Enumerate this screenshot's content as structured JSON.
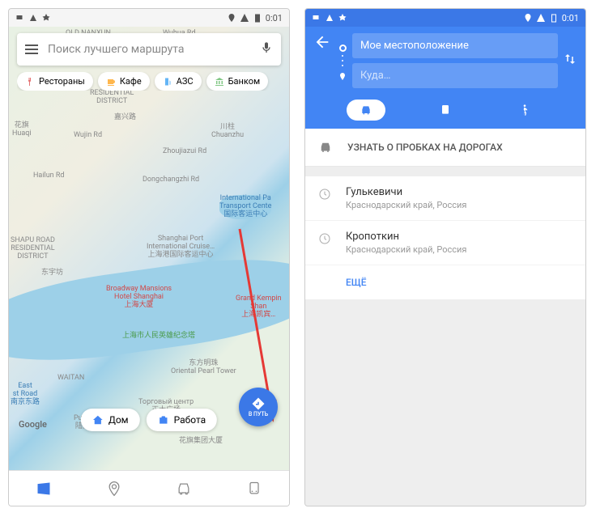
{
  "status": {
    "time": "0:01"
  },
  "left": {
    "search_placeholder": "Поиск лучшего маршрута",
    "chips": {
      "restaurants": "Рестораны",
      "cafe": "Кафе",
      "gas": "АЗС",
      "bank": "Банком"
    },
    "home_label": "Дом",
    "work_label": "Работа",
    "fab_label": "В ПУТЬ",
    "google": "Google",
    "map_labels": {
      "nanxun": "OLD NANXUN",
      "wuhua": "Wuhua Rd",
      "residential": "RESIDENTIAL\nDISTRICT",
      "jiaxing": "嘉兴路",
      "huaqi": "花旗\nHuaqi",
      "chuanzhu": "川柱\nChuanzhu",
      "zhoujia": "Zhoujiazui Rd",
      "dongchang": "Dongchangzhi Rd",
      "transport": "International Pa\nTransport Cente\n国际客运中心",
      "wujin": "Wujin Rd",
      "haining": "Hailun Rd",
      "port": "Shanghai Port\nInternational Cruise…\n上海港国际客运中心",
      "shapu": "SHAPU ROAD\nRESIDENTIAL\nDISTRICT",
      "dongyu": "东宇坊",
      "broadway": "Broadway Mansions\nHotel Shanghai\n上海大厦",
      "kempin": "Grand Kempin\nShan\n上海凯宾…",
      "heroes": "上海市人民英雄纪念塔",
      "pearl": "东方明珠\nOriental Pearl Tower",
      "waitan": "WAITAN",
      "ecroad": "East\nst Road\n南京东路",
      "shopping": "Торговый центр\n正大广场",
      "pudong": "Pudong\n陆家嘴",
      "huaqi2": "花旗集团大厦"
    }
  },
  "right": {
    "origin": "Мое местоположение",
    "dest_placeholder": "Куда…",
    "traffic_title": "УЗНАТЬ О ПРОБКАХ НА ДОРОГАХ",
    "recents": [
      {
        "name": "Гулькевичи",
        "sub": "Краснодарский край, Россия"
      },
      {
        "name": "Кропоткин",
        "sub": "Краснодарский край, Россия"
      }
    ],
    "more": "ЕЩЁ"
  }
}
